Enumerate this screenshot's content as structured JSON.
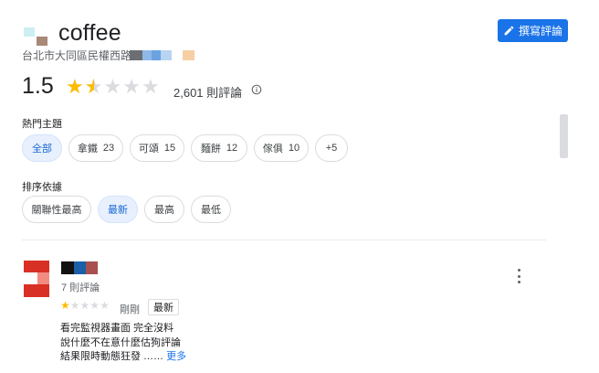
{
  "header": {
    "title": "coffee",
    "address": "台北市大同區民權西路",
    "write_review_label": "撰寫評論",
    "write_review_icon": "pencil-icon"
  },
  "rating": {
    "score": "1.5",
    "score_value": 1.5,
    "max_stars": 5,
    "count_label": "2,601 則評論",
    "info_icon": "info-icon"
  },
  "topics": {
    "label": "熱門主題",
    "chips": [
      {
        "label": "全部",
        "count": "",
        "selected": true
      },
      {
        "label": "拿鐵",
        "count": "23",
        "selected": false
      },
      {
        "label": "可頌",
        "count": "15",
        "selected": false
      },
      {
        "label": "麵餅",
        "count": "12",
        "selected": false
      },
      {
        "label": "傢俱",
        "count": "10",
        "selected": false
      },
      {
        "label": "+5",
        "count": "",
        "selected": false
      }
    ]
  },
  "sort": {
    "label": "排序依據",
    "chips": [
      {
        "label": "關聯性最高",
        "selected": false
      },
      {
        "label": "最新",
        "selected": true
      },
      {
        "label": "最高",
        "selected": false
      },
      {
        "label": "最低",
        "selected": false
      }
    ]
  },
  "review": {
    "reviewer_meta": "7 則評論",
    "rating": 1,
    "time": "剛剛",
    "badge": "最新",
    "lines": [
      "看完監視器畫面 完全沒料",
      "說什麼不在意什麼估狗評論",
      "結果限時動態狂發 ……"
    ],
    "more_label": "更多",
    "menu_icon": "more-vert-icon"
  },
  "colors": {
    "accent": "#1a73e8",
    "star": "#fbbc04",
    "chip_selected_bg": "#e8f0fe"
  }
}
